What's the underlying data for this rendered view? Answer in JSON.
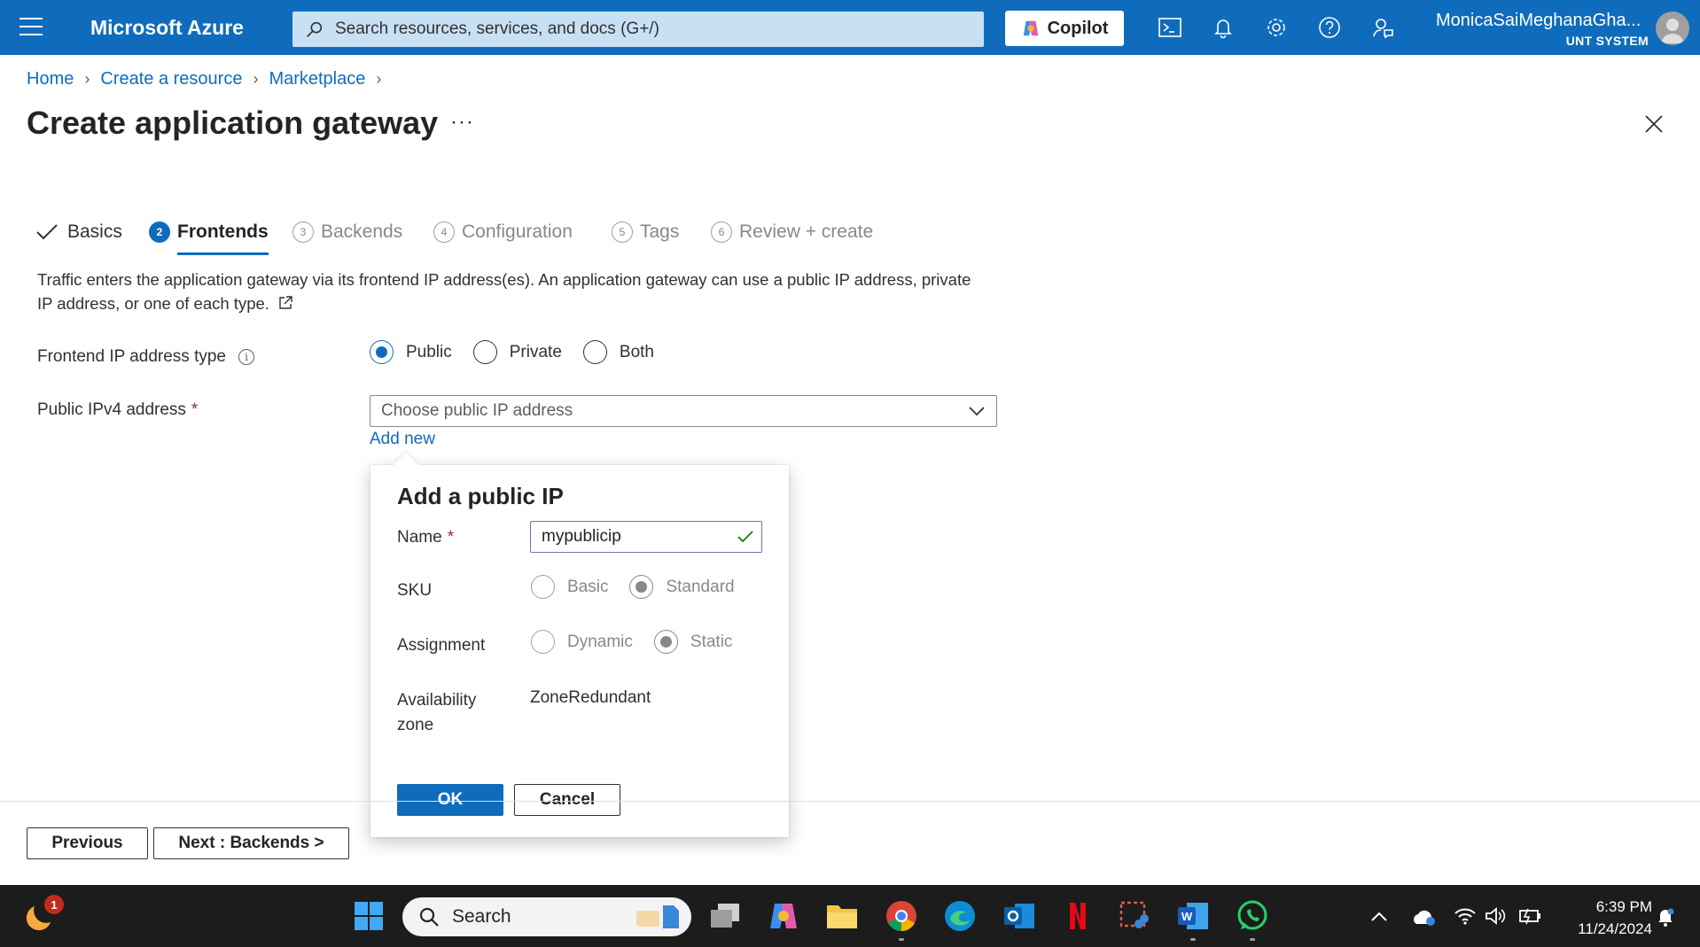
{
  "topbar": {
    "brand": "Microsoft Azure",
    "search_placeholder": "Search resources, services, and docs (G+/)",
    "copilot_label": "Copilot",
    "user_name": "MonicaSaiMeghanaGha...",
    "user_org": "UNT SYSTEM",
    "icons": [
      "hamburger-icon",
      "cloud-shell-icon",
      "bell-icon",
      "gear-icon",
      "help-icon",
      "feedback-icon"
    ]
  },
  "breadcrumb": {
    "items": [
      "Home",
      "Create a resource",
      "Marketplace"
    ]
  },
  "page": {
    "title": "Create application gateway",
    "more": "···"
  },
  "tabs": [
    {
      "num": "",
      "label": "Basics",
      "state": "done"
    },
    {
      "num": "2",
      "label": "Frontends",
      "state": "active"
    },
    {
      "num": "3",
      "label": "Backends",
      "state": "pending"
    },
    {
      "num": "4",
      "label": "Configuration",
      "state": "pending"
    },
    {
      "num": "5",
      "label": "Tags",
      "state": "pending"
    },
    {
      "num": "6",
      "label": "Review + create",
      "state": "pending"
    }
  ],
  "form": {
    "description": "Traffic enters the application gateway via its frontend IP address(es). An application gateway can use a public IP address, private IP address, or one of each type.",
    "ip_type_label": "Frontend IP address type",
    "ip_type_options": [
      "Public",
      "Private",
      "Both"
    ],
    "ip_type_selected": "Public",
    "ipv4_label": "Public IPv4 address",
    "required_mark": "*",
    "ipv4_placeholder": "Choose public IP address",
    "add_new": "Add new"
  },
  "callout": {
    "title": "Add a public IP",
    "name_label": "Name",
    "name_value": "mypublicip",
    "sku_label": "SKU",
    "sku_options": [
      "Basic",
      "Standard"
    ],
    "sku_selected": "Standard",
    "assignment_label": "Assignment",
    "assignment_options": [
      "Dynamic",
      "Static"
    ],
    "assignment_selected": "Static",
    "az_label_line1": "Availability",
    "az_label_line2": "zone",
    "az_value": "ZoneRedundant",
    "ok": "OK",
    "cancel": "Cancel"
  },
  "footer": {
    "previous": "Previous",
    "next": "Next : Backends >"
  },
  "taskbar": {
    "search": "Search",
    "notification_badge": "1",
    "time": "6:39 PM",
    "date": "11/24/2024"
  },
  "colors": {
    "azure_blue": "#0f6cbd",
    "search_bg": "#c7e0f4",
    "validation_purple": "#8764b8",
    "check_green": "#107c10",
    "taskbar_bg": "#1c1c1c"
  }
}
